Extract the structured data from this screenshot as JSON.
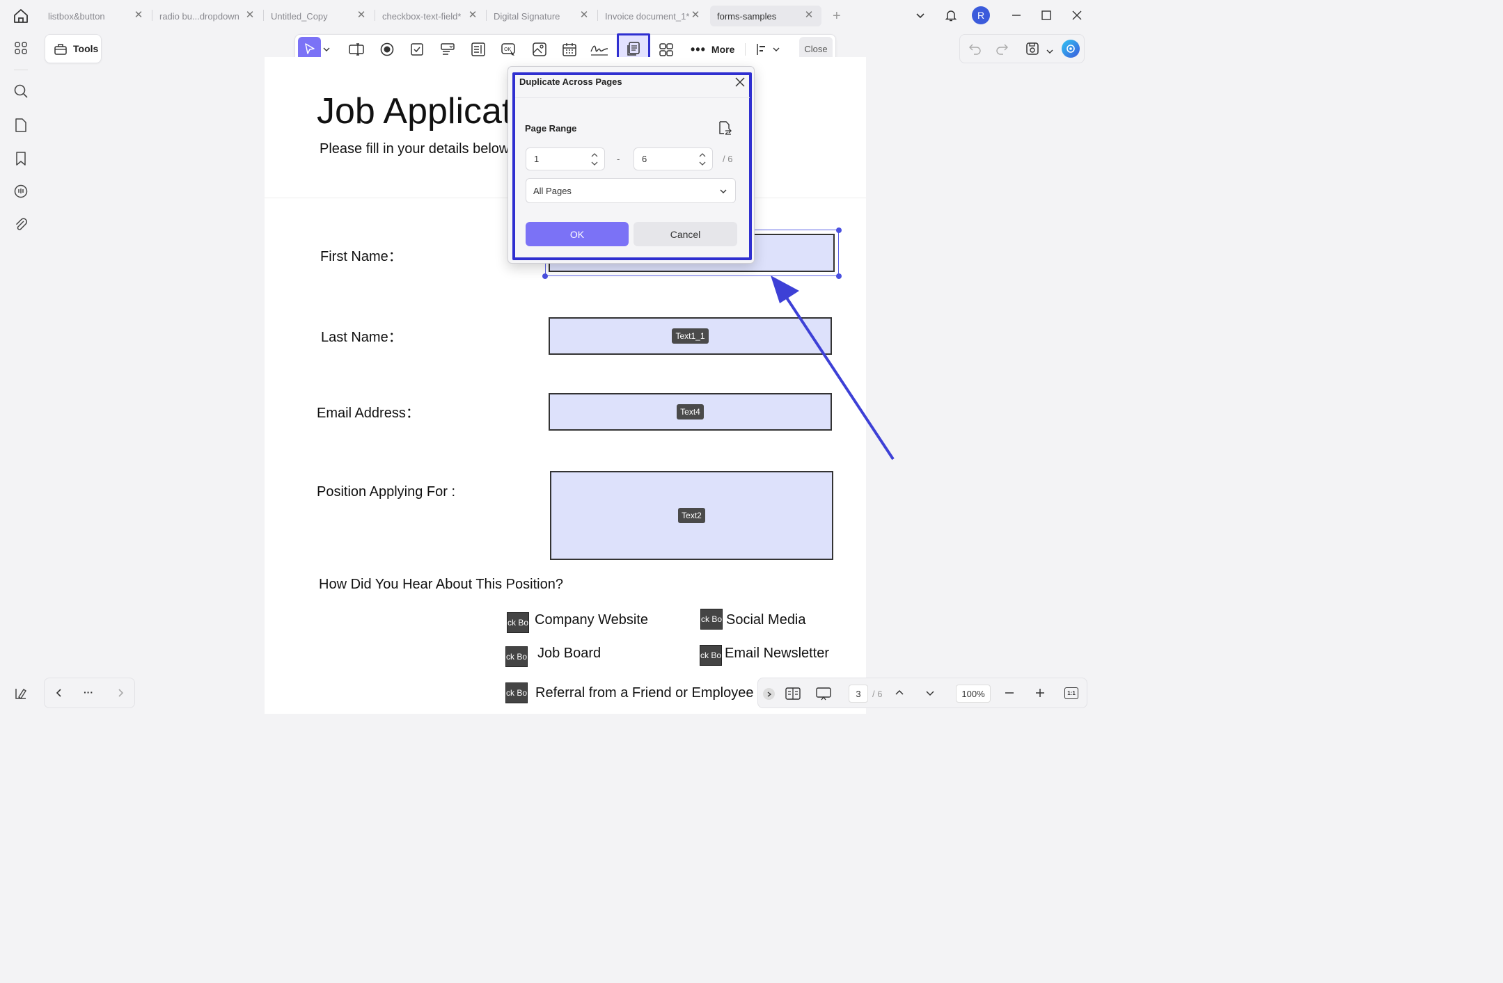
{
  "tabs": [
    {
      "label": "listbox&button",
      "active": false
    },
    {
      "label": "radio bu...dropdown",
      "active": false
    },
    {
      "label": "Untitled_Copy",
      "active": false
    },
    {
      "label": "checkbox-text-field*",
      "active": false
    },
    {
      "label": "Digital Signature",
      "active": false
    },
    {
      "label": "Invoice document_1*",
      "active": false
    },
    {
      "label": "forms-samples",
      "active": true
    }
  ],
  "user": {
    "avatar_letter": "R",
    "avatar_color": "#3b5bdb"
  },
  "toolbar": {
    "tools_label": "Tools",
    "more_label": "More",
    "close_label": "Close",
    "accent": "#7b72f6",
    "highlight": "#2f2fd0"
  },
  "document": {
    "title": "Job Application",
    "subtitle": "Please fill in your details below",
    "fields": [
      {
        "label": "First Name：",
        "tag": ""
      },
      {
        "label": "Last Name：",
        "tag": "Text1_1"
      },
      {
        "label": "Email Address：",
        "tag": "Text4"
      },
      {
        "label": "Position Applying For :",
        "tag": "Text2"
      }
    ],
    "question": "How Did You Hear About This Position?",
    "checkbox_tag": "eck Bo",
    "options": [
      "Company Website",
      "Social Media",
      "Job Board",
      "Email Newsletter",
      "Referral from a Friend or Employee"
    ]
  },
  "dialog": {
    "title": "Duplicate Across Pages",
    "page_range_label": "Page Range",
    "from_value": "1",
    "dash": "-",
    "to_value": "6",
    "total": "/ 6",
    "select_value": "All Pages",
    "ok_label": "OK",
    "cancel_label": "Cancel"
  },
  "statusbar": {
    "current_page": "3",
    "total_pages": "/ 6",
    "zoom": "100%",
    "fit_label": "1:1"
  },
  "navbar": {
    "more_label": "···"
  }
}
